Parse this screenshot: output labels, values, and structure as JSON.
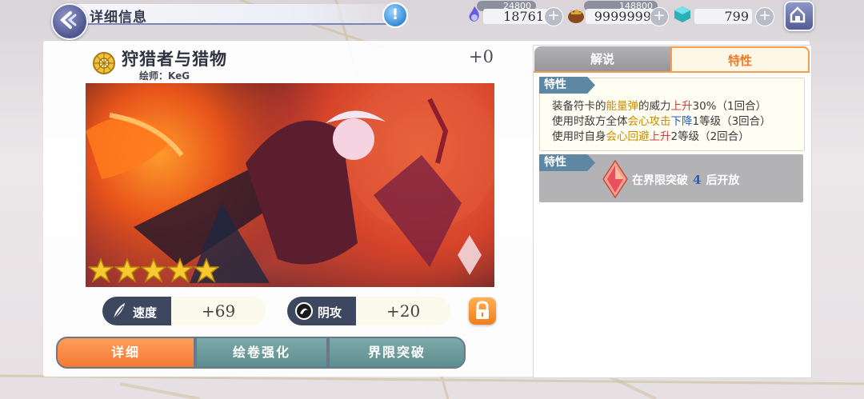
{
  "header": {
    "title": "详细信息",
    "info_icon": "info-icon"
  },
  "resources": {
    "stamina": {
      "icon": "spirit-flame-icon",
      "cap": "24800",
      "value": "18761"
    },
    "money": {
      "icon": "money-bag-icon",
      "cap": "148800",
      "value": "9999999"
    },
    "gems": {
      "icon": "gem-cube-icon",
      "value": "799"
    }
  },
  "card": {
    "name": "狩猎者与猎物",
    "artist": "绘师：KeG",
    "level": "+0",
    "stars": 5,
    "stats": [
      {
        "label": "速度",
        "value": "+69",
        "icon": "feather-icon"
      },
      {
        "label": "阴攻",
        "value": "+20",
        "icon": "yin-attack-icon"
      }
    ]
  },
  "bottom_tabs": {
    "detail": "详细",
    "enhance": "绘卷强化",
    "breakthrough": "界限突破"
  },
  "right_tabs": {
    "description": "解说",
    "traits": "特性"
  },
  "traits": {
    "tag": "特性",
    "line1": {
      "a": "装备符卡的",
      "b": "能量弹",
      "c": "的威力",
      "d": "上升",
      "e": "30%（1回合）"
    },
    "line2": {
      "a": "使用时敌方全体",
      "b": "会心攻击",
      "c": "下降",
      "d": "1等级（3回合）"
    },
    "line3": {
      "a": "使用时自身",
      "b": "会心回避",
      "c": "上升",
      "d": "2等级（2回合）"
    }
  },
  "locked_trait": {
    "tag": "特性",
    "prefix": "在界限突破",
    "num": "4",
    "suffix": "后开放"
  },
  "colors": {
    "accent_orange": "#f27a32",
    "teal_tab": "#5d8d8f",
    "navy": "#3e4760"
  }
}
